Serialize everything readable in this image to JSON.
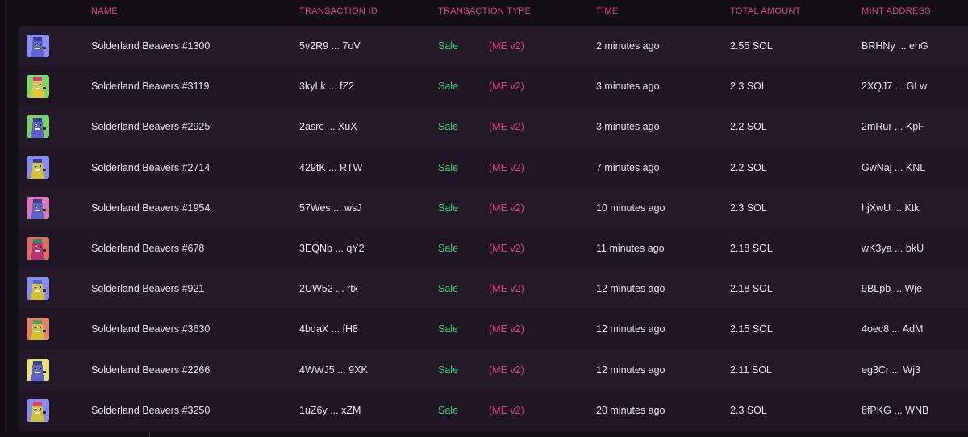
{
  "columns": {
    "name": "NAME",
    "transaction_id": "TRANSACTION ID",
    "transaction_type": "TRANSACTION TYPE",
    "time": "TIME",
    "total_amount": "TOTAL AMOUNT",
    "mint_address": "MINT ADDRESS"
  },
  "rows": [
    {
      "name": "Solderland Beavers #1300",
      "txid": "5v2R9 ... 7oV",
      "type": "Sale",
      "market": "(ME v2)",
      "time": "2 minutes ago",
      "amount": "2.55 SOL",
      "mint": "BRHNy ... ehG",
      "bg": "#8c8ff2",
      "body": "#5d63d6",
      "hat": "#3b3f9a"
    },
    {
      "name": "Solderland Beavers #3119",
      "txid": "3kyLk ... fZ2",
      "type": "Sale",
      "market": "(ME v2)",
      "time": "3 minutes ago",
      "amount": "2.3 SOL",
      "mint": "2XQJ7 ... GLw",
      "bg": "#7ed66f",
      "body": "#d9c83c",
      "hat": "#d8407a"
    },
    {
      "name": "Solderland Beavers #2925",
      "txid": "2asrc ... XuX",
      "type": "Sale",
      "market": "(ME v2)",
      "time": "3 minutes ago",
      "amount": "2.2 SOL",
      "mint": "2mRur ... KpF",
      "bg": "#7ccf6a",
      "body": "#5e63c9",
      "hat": "#3a3f8f"
    },
    {
      "name": "Solderland Beavers #2714",
      "txid": "429tK ... RTW",
      "type": "Sale",
      "market": "(ME v2)",
      "time": "7 minutes ago",
      "amount": "2.2 SOL",
      "mint": "GwNaj ... KNL",
      "bg": "#8a8df0",
      "body": "#cfc23a",
      "hat": "#3b3f9a"
    },
    {
      "name": "Solderland Beavers #1954",
      "txid": "57Wes ... wsJ",
      "type": "Sale",
      "market": "(ME v2)",
      "time": "10 minutes ago",
      "amount": "2.3 SOL",
      "mint": "hjXwU ... Ktk",
      "bg": "#d87ab4",
      "body": "#5e63c9",
      "hat": "#3a3f8f"
    },
    {
      "name": "Solderland Beavers #678",
      "txid": "3EQNb ... qY2",
      "type": "Sale",
      "market": "(ME v2)",
      "time": "11 minutes ago",
      "amount": "2.18 SOL",
      "mint": "wK3ya ... bkU",
      "bg": "#d8706a",
      "body": "#c0316f",
      "hat": "#2a8f6a"
    },
    {
      "name": "Solderland Beavers #921",
      "txid": "2UW52 ... rtx",
      "type": "Sale",
      "market": "(ME v2)",
      "time": "12 minutes ago",
      "amount": "2.18 SOL",
      "mint": "9BLpb ... Wje",
      "bg": "#8a8df0",
      "body": "#cfc23a",
      "hat": "#5e63c9"
    },
    {
      "name": "Solderland Beavers #3630",
      "txid": "4bdaX ... fH8",
      "type": "Sale",
      "market": "(ME v2)",
      "time": "12 minutes ago",
      "amount": "2.15 SOL",
      "mint": "4oec8 ... AdM",
      "bg": "#e0826e",
      "body": "#cfc23a",
      "hat": "#5a9a5a"
    },
    {
      "name": "Solderland Beavers #2266",
      "txid": "4WWJ5 ... 9XK",
      "type": "Sale",
      "market": "(ME v2)",
      "time": "12 minutes ago",
      "amount": "2.11 SOL",
      "mint": "eg3Cr ... Wj3",
      "bg": "#e6e078",
      "body": "#5e63c9",
      "hat": "#3a3f8f"
    },
    {
      "name": "Solderland Beavers #3250",
      "txid": "1uZ6y ... xZM",
      "type": "Sale",
      "market": "(ME v2)",
      "time": "20 minutes ago",
      "amount": "2.3 SOL",
      "mint": "8fPKG ... WNB",
      "bg": "#8a8df0",
      "body": "#cfc23a",
      "hat": "#d8407a"
    }
  ]
}
